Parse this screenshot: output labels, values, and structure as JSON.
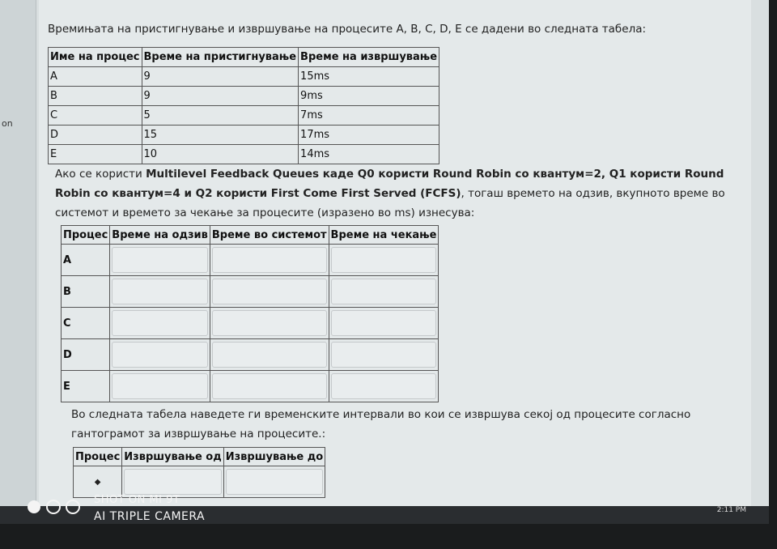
{
  "sidebar": {
    "label": "on"
  },
  "intro": "Времињата на пристигнување и извршување на процесите A, B, C, D, E се дадени во следната табела:",
  "table1": {
    "headers": [
      "Име на процес",
      "Време на пристигнување",
      "Време на извршување"
    ],
    "rows": [
      [
        "A",
        "9",
        "15ms"
      ],
      [
        "B",
        "9",
        "9ms"
      ],
      [
        "C",
        "5",
        "7ms"
      ],
      [
        "D",
        "15",
        "17ms"
      ],
      [
        "E",
        "10",
        "14ms"
      ]
    ]
  },
  "paragraph": {
    "p1": "Ако се користи ",
    "bold": "Multilevel Feedback Queues каде Q0 користи Round Robin со квантум=2, Q1 користи Round Robin со квантум=4 и Q2 користи First Come First Served (FCFS)",
    "p2": ", тогаш времето на одзив, вкупното време во системот и времето за чекање за процесите (изразено во ms) изнесува:"
  },
  "table2": {
    "headers": [
      "Процес",
      "Време на одзив",
      "Време во системот",
      "Време на чекање"
    ],
    "rows": [
      "A",
      "B",
      "C",
      "D",
      "E"
    ]
  },
  "paragraph2": "Во следната табела наведете ги временските интервали во кои се извршува секој од процесите согласно гантограмот за извршување на процесите.:",
  "table3": {
    "headers": [
      "Процес",
      "Извршување од",
      "Извршување до"
    ],
    "select_icon": "sort-icon"
  },
  "taskbar": {
    "time": "2:11 PM"
  },
  "watermark": {
    "line1": "SHOT ON MI 9T",
    "line2": "AI TRIPLE CAMERA"
  }
}
